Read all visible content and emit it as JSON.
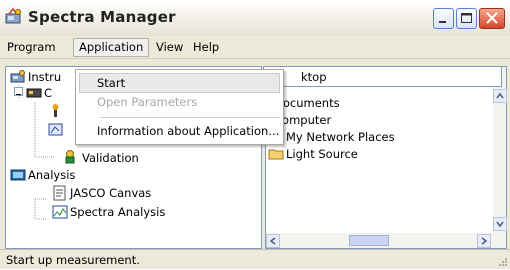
{
  "window": {
    "title": "Spectra Manager"
  },
  "menubar": {
    "items": [
      "Program",
      "Application",
      "View",
      "Help"
    ]
  },
  "dropdown": {
    "items": [
      {
        "label": "Start"
      },
      {
        "label": "Open Parameters"
      },
      {
        "label": "Information about Application..."
      }
    ]
  },
  "tree": {
    "instruments_label": "Instru",
    "sub_label": "C",
    "validation_label": "Validation",
    "analysis_label": "Analysis",
    "jasco_canvas_label": "JASCO Canvas",
    "spectra_analysis_label": "Spectra Analysis"
  },
  "address": {
    "value": "ktop"
  },
  "list": {
    "items": [
      "Documents",
      "Computer",
      "My Network Places",
      "Light Source"
    ]
  },
  "status": {
    "text": "Start up measurement."
  },
  "colors": {
    "selection": "#e9e9e9",
    "border": "#7f9db9",
    "close_button": "#d4452a"
  }
}
